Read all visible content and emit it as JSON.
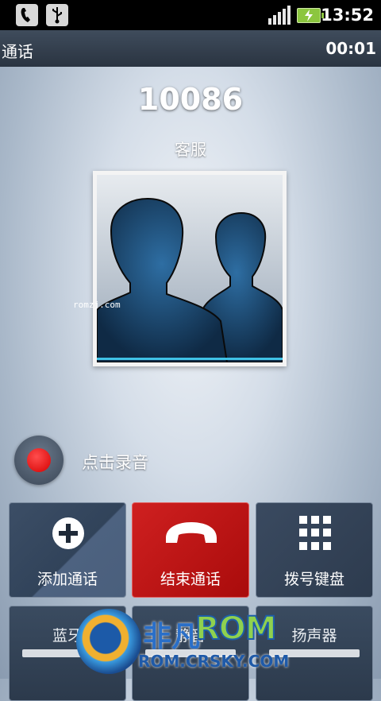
{
  "status_bar": {
    "icons": [
      "phone-icon",
      "usb-icon",
      "signal-icon",
      "battery-charging-icon"
    ],
    "time": "13:52"
  },
  "call_header": {
    "title": "通话",
    "timer": "00:01"
  },
  "caller": {
    "number": "10086",
    "label": "客服",
    "photo_watermark": "romzj.com"
  },
  "record": {
    "label": "点击录音"
  },
  "buttons": {
    "add_call": "添加通话",
    "end_call": "结束通话",
    "dialpad": "拨号键盘",
    "bluetooth": "蓝牙",
    "mute": "静音",
    "speaker": "扬声器"
  },
  "watermark": {
    "brand_cn": "非凡",
    "brand_rom": "ROM",
    "url": "ROM.CRSKY.COM"
  },
  "colors": {
    "end_call": "#c01515",
    "accent_cyan": "#3fc2e6",
    "battery": "#8cc63f"
  }
}
